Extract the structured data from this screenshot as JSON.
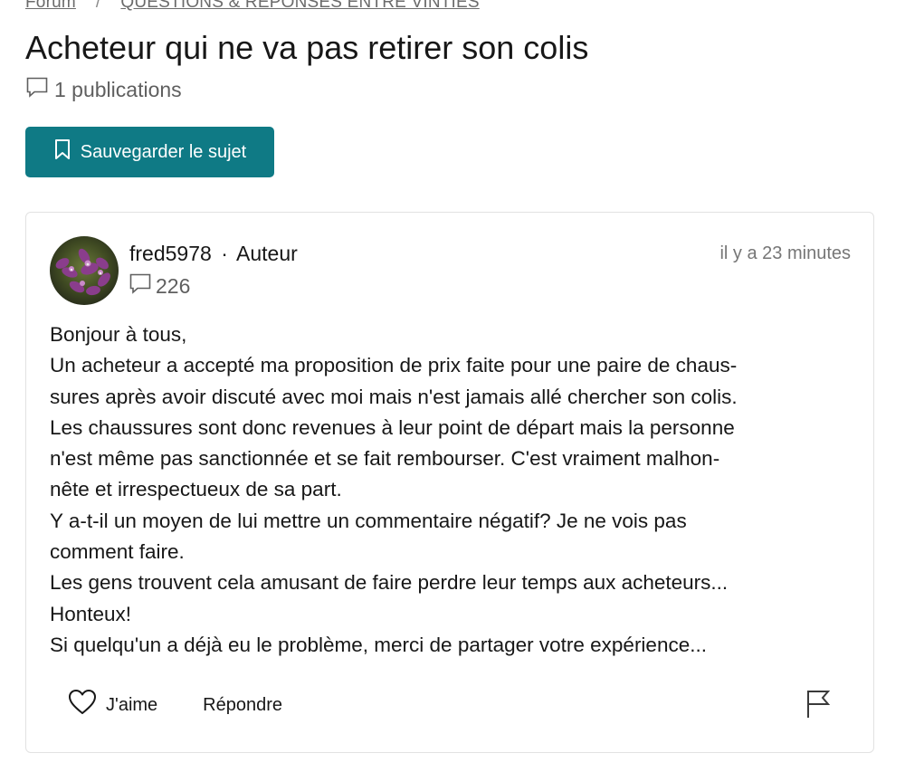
{
  "breadcrumb": {
    "items": [
      {
        "label": "Forum"
      },
      {
        "label": "QUESTIONS & RÉPONSES ENTRE VINTIES"
      }
    ],
    "separator": "/"
  },
  "topic": {
    "title": "Acheteur qui ne va pas retirer son colis",
    "publications_count": "1 publications",
    "save_label": "Sauvegarder le sujet"
  },
  "post": {
    "author": "fred5978",
    "separator": "·",
    "role": "Auteur",
    "author_post_count": "226",
    "timestamp": "il y a 23 minutes",
    "body_lines": [
      "Bonjour à tous,",
      "Un acheteur a accepté ma proposition de prix faite pour une paire de chaus-",
      "sures après avoir discuté avec moi mais n'est jamais allé chercher son colis.",
      "Les chaussures sont donc revenues à leur point de départ mais la personne",
      "n'est même pas sanctionnée et se fait rembourser. C'est vraiment malhon-",
      "nête et irrespectueux de sa part.",
      "Y a-t-il un moyen de lui mettre un commentaire négatif? Je ne vois pas",
      "comment faire.",
      "Les gens trouvent cela amusant de faire perdre leur temps aux acheteurs...",
      "Honteux!",
      "Si quelqu'un a déjà eu le problème, merci de partager votre expérience..."
    ],
    "actions": {
      "like_label": "J'aime",
      "reply_label": "Répondre"
    }
  },
  "colors": {
    "accent": "#0f7a85",
    "text": "#171717",
    "muted": "#6b6b6b",
    "border": "#e2e2e2"
  },
  "icons": {
    "comment": "speech-bubble-icon",
    "bookmark": "bookmark-icon",
    "like": "heart-icon",
    "report": "flag-icon"
  }
}
